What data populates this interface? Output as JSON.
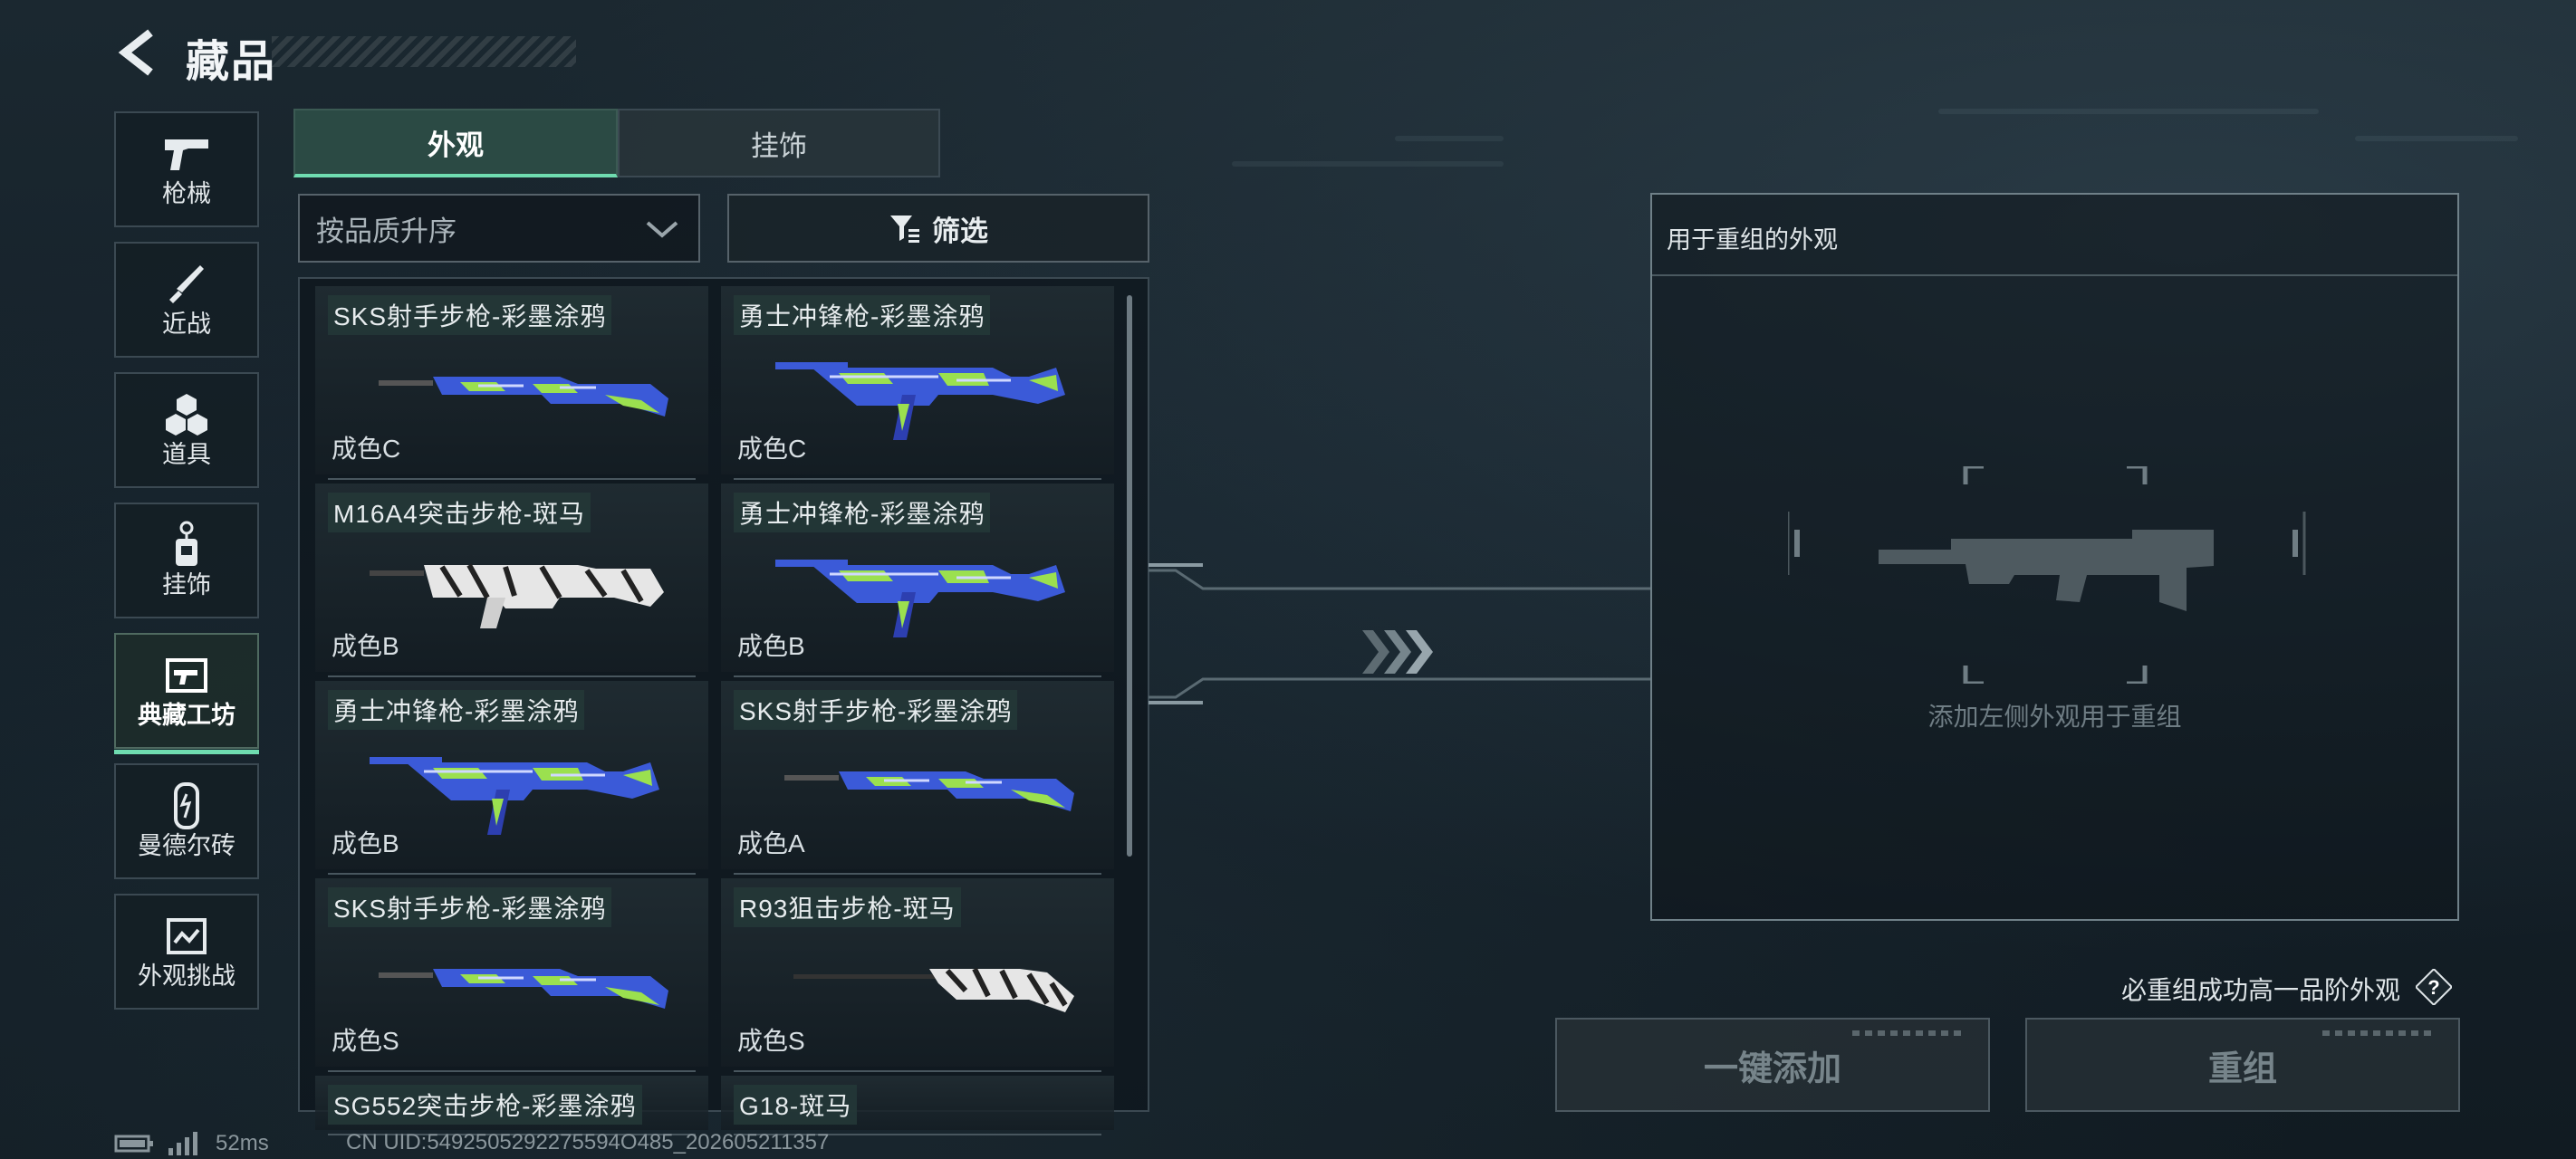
{
  "header": {
    "title": "藏品",
    "back_icon": "back-arrow-icon"
  },
  "sidebar": {
    "items": [
      {
        "label": "枪械",
        "icon": "pistol-icon",
        "active": false
      },
      {
        "label": "近战",
        "icon": "knife-icon",
        "active": false
      },
      {
        "label": "道具",
        "icon": "cubes-icon",
        "active": false
      },
      {
        "label": "挂饰",
        "icon": "charm-icon",
        "active": false
      },
      {
        "label": "典藏工坊",
        "icon": "workshop-icon",
        "active": true
      },
      {
        "label": "曼德尔砖",
        "icon": "brick-icon",
        "active": false
      },
      {
        "label": "外观挑战",
        "icon": "challenge-icon",
        "active": false
      }
    ]
  },
  "tabs": {
    "items": [
      {
        "label": "外观",
        "active": true
      },
      {
        "label": "挂饰",
        "active": false
      }
    ]
  },
  "sort": {
    "value": "按品质升序"
  },
  "filter": {
    "label": "筛选"
  },
  "skins": [
    {
      "name": "SKS射手步枪-彩墨涂鸦",
      "grade": "成色C",
      "pattern": "ink"
    },
    {
      "name": "勇士冲锋枪-彩墨涂鸦",
      "grade": "成色C",
      "pattern": "ink"
    },
    {
      "name": "M16A4突击步枪-斑马",
      "grade": "成色B",
      "pattern": "zebra"
    },
    {
      "name": "勇士冲锋枪-彩墨涂鸦",
      "grade": "成色B",
      "pattern": "ink"
    },
    {
      "name": "勇士冲锋枪-彩墨涂鸦",
      "grade": "成色B",
      "pattern": "ink"
    },
    {
      "name": "SKS射手步枪-彩墨涂鸦",
      "grade": "成色A",
      "pattern": "ink"
    },
    {
      "name": "SKS射手步枪-彩墨涂鸦",
      "grade": "成色S",
      "pattern": "ink"
    },
    {
      "name": "R93狙击步枪-斑马",
      "grade": "成色S",
      "pattern": "zebra"
    },
    {
      "name": "SG552突击步枪-彩墨涂鸦",
      "grade": "",
      "pattern": "ink"
    },
    {
      "name": "G18-斑马",
      "grade": "",
      "pattern": "zebra"
    }
  ],
  "panel": {
    "title": "用于重组的外观",
    "hint": "添加左侧外观用于重组"
  },
  "note": "必重组成功高一品阶外观",
  "buttons": {
    "add": "一键添加",
    "recombine": "重组"
  },
  "status": {
    "ping": "52ms",
    "uid": "CN UID:5492505292275594O485_202605211357"
  },
  "colors": {
    "accent": "#6fdcb0",
    "ink_green": "#8fe04a",
    "ink_blue": "#2f4ed8",
    "zebra_white": "#e8e8e8"
  }
}
